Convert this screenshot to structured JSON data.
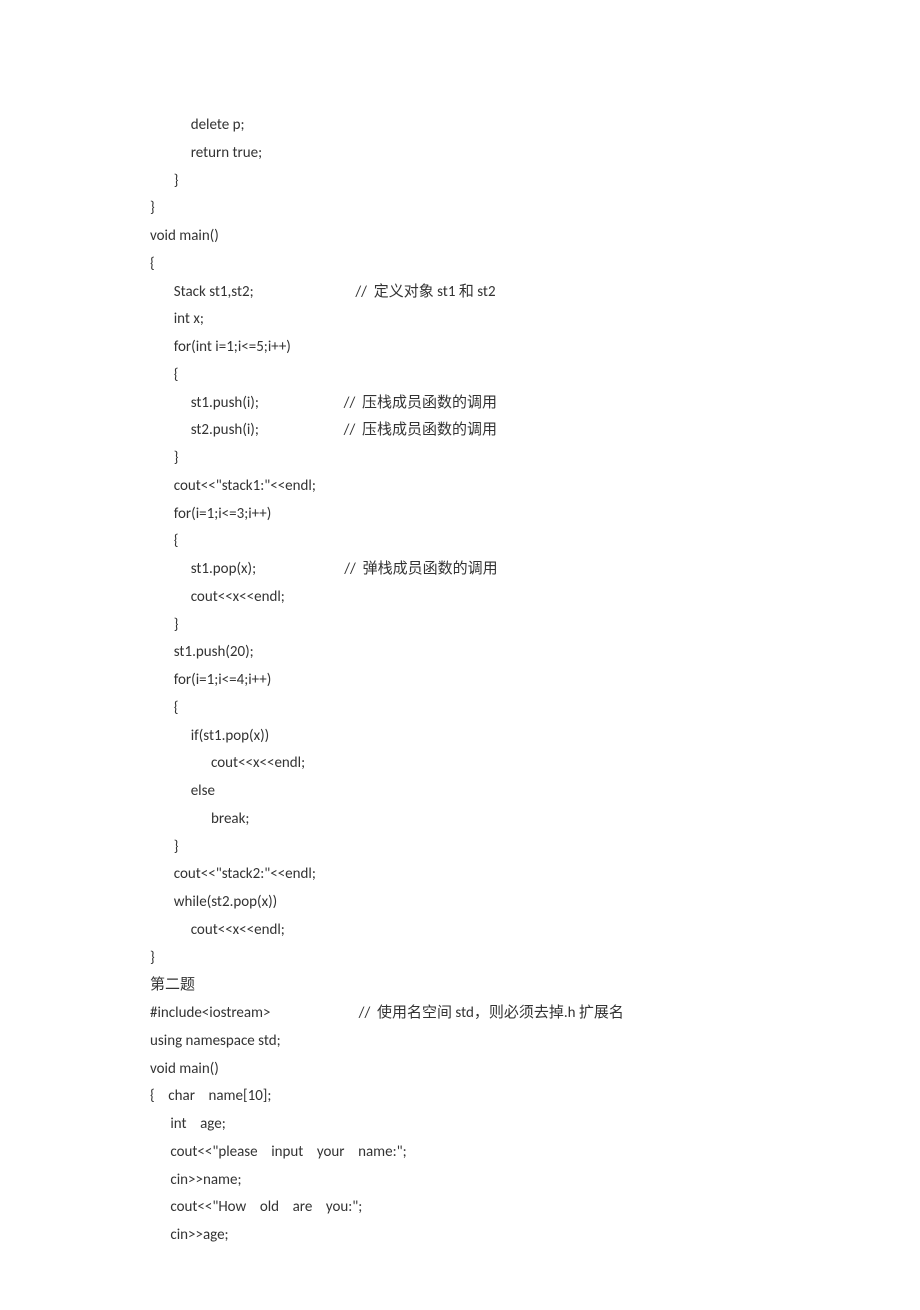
{
  "lines": [
    "            delete p;",
    "            return true;",
    "       }",
    "}",
    "",
    "void main()",
    "{",
    "       Stack st1,st2;                              //  定义对象 st1 和 st2",
    "       int x;",
    "       for(int i=1;i<=5;i++)",
    "       {",
    "            st1.push(i);                         //  压栈成员函数的调用",
    "            st2.push(i);                         //  压栈成员函数的调用",
    "       }",
    "       cout<<\"stack1:\"<<endl;",
    "       for(i=1;i<=3;i++)",
    "       {",
    "            st1.pop(x);                          //  弹栈成员函数的调用",
    "            cout<<x<<endl;",
    "       }",
    "       st1.push(20);",
    "       for(i=1;i<=4;i++)",
    "       {",
    "            if(st1.pop(x))",
    "                  cout<<x<<endl;",
    "            else",
    "                  break;",
    "       }",
    "       cout<<\"stack2:\"<<endl;",
    "       while(st2.pop(x))",
    "            cout<<x<<endl;",
    "}",
    "",
    "",
    "第二题",
    "#include<iostream>                          //  使用名空间 std，则必须去掉.h 扩展名",
    "using namespace std;",
    "void main()",
    "{    char    name[10];",
    "      int    age;",
    "      cout<<\"please    input    your    name:\";",
    "      cin>>name;",
    "      cout<<\"How    old    are    you:\";",
    "      cin>>age;"
  ]
}
